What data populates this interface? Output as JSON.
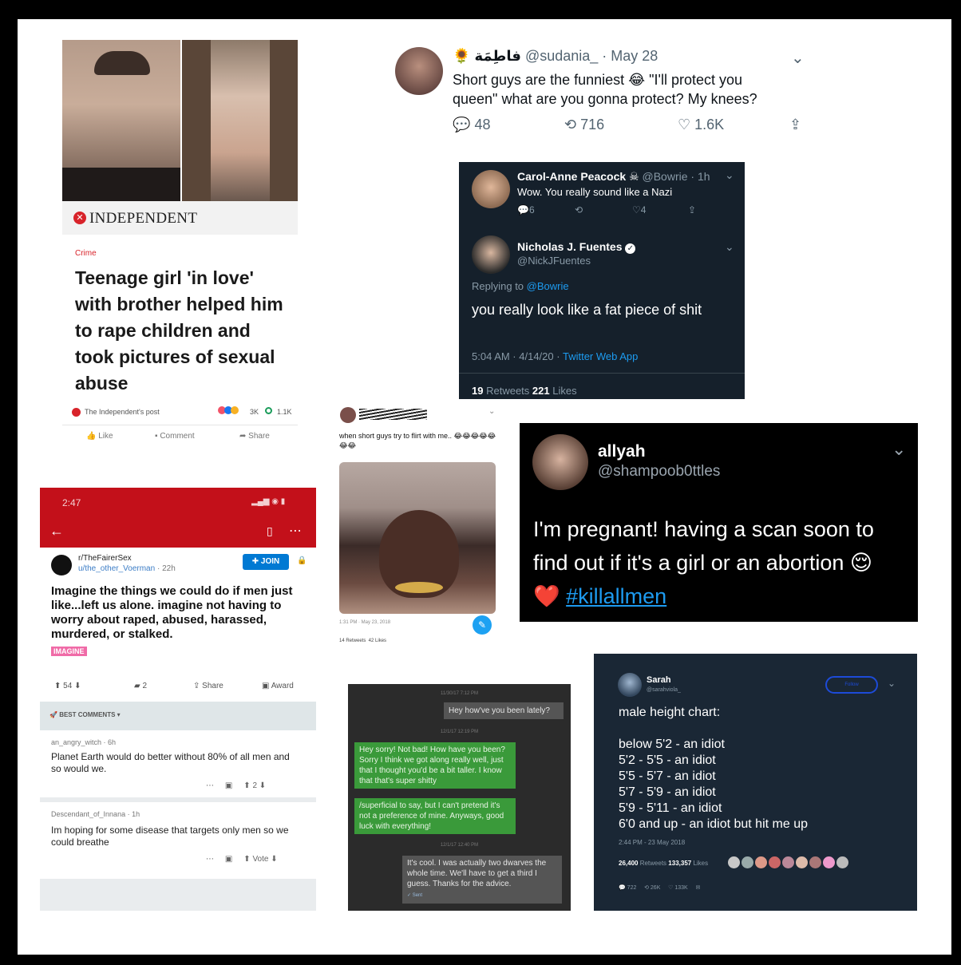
{
  "independent": {
    "brand": "INDEPENDENT",
    "section": "Crime",
    "headline": "Teenage girl 'in love' with brother helped him to rape children and took pictures of sexual abuse",
    "post_source": "The Independent's post",
    "reactions": "3K",
    "comments": "1.1K",
    "like": "Like",
    "comment": "Comment",
    "share": "Share"
  },
  "sudania": {
    "name": "فاطِمَة",
    "handle": "@sudania_",
    "date": "· May 28",
    "text": "Short guys are the funniest 😂 \"I'll protect you queen\" what are you gonna protect? My knees?",
    "replies": "48",
    "retweets": "716",
    "likes": "1.6K"
  },
  "fuentes": {
    "carol_name": "Carol-Anne Peacock ☠",
    "carol_handle": "@Bowrie · 1h",
    "carol_text": "Wow. You really sound like a Nazi",
    "carol_replies": "6",
    "carol_likes": "4",
    "name": "Nicholas J. Fuentes",
    "handle": "@NickJFuentes",
    "replying": "Replying to",
    "replying_to": "@Bowrie",
    "text": "you really look like a fat piece of shit",
    "time": "5:04 AM · 4/14/20 ·",
    "via": "Twitter Web App",
    "retweets": "19",
    "retweets_label": "Retweets",
    "likes": "221",
    "likes_label": "Likes"
  },
  "flirt": {
    "caption": "when short guys try to flirt with me.. 😂😂😂😂😂😂😂",
    "time": "1:31 PM · May 23, 2018",
    "stats": "14 Retweets  42 Likes"
  },
  "allyah": {
    "name": "allyah",
    "handle": "@shampoob0ttles",
    "text": "I'm pregnant! having a scan soon to find out if it's a girl or an abortion 😌",
    "heart": "❤️",
    "hashtag": "#killallmen"
  },
  "reddit": {
    "time": "2:47",
    "sub": "r/TheFairerSex",
    "user": "u/the_other_Voerman",
    "age": "· 22h",
    "join": "JOIN",
    "title": "Imagine the things we could do if men just like...left us alone. imagine not having to worry about raped, abused, harassed, murdered, or stalked.",
    "flair": "IMAGINE",
    "votes": "54",
    "comments": "2",
    "share": "Share",
    "award": "Award",
    "best": "BEST COMMENTS",
    "c1_user": "an_angry_witch · 6h",
    "c1_text": "Planet Earth would do better without 80% of all men and so would we.",
    "c1_votes": "2",
    "c2_user": "Descendant_of_Innana · 1h",
    "c2_text": "Im hoping for some disease that targets only men so we could breathe",
    "c2_vote": "Vote"
  },
  "sms": {
    "t1": "11/30/17 7:12 PM",
    "m1": "Hey how've you been lately?",
    "t2": "12/1/17 12:19 PM",
    "m2": "Hey sorry! Not bad! How have you been? Sorry I think we got along really well, just that I thought you'd be a bit taller. I know that that's super shitty",
    "m3": "/superficial to say, but I can't pretend it's not a preference of mine. Anyways, good luck with everything!",
    "t3": "12/1/17 12:40 PM",
    "m4": "It's cool. I was actually two dwarves the whole time. We'll have to get a third I guess. Thanks for the advice.",
    "sent": "✓ Sent"
  },
  "sarah": {
    "name": "Sarah",
    "handle": "@sarahviola_",
    "follow": "Follow",
    "lines": [
      "male height chart:",
      "",
      "below 5'2 - an idiot",
      "5'2 - 5'5 - an idiot",
      "5'5 - 5'7 - an idiot",
      "5'7 - 5'9 - an idiot",
      "5'9 - 5'11 - an idiot",
      "6'0 and up - an idiot but hit me up"
    ],
    "time": "2:44 PM - 23 May 2018",
    "retweets": "26,400",
    "retweets_label": "Retweets",
    "likes": "133,357",
    "likes_label": "Likes",
    "replies": "722",
    "rt_short": "26K",
    "like_short": "133K"
  }
}
